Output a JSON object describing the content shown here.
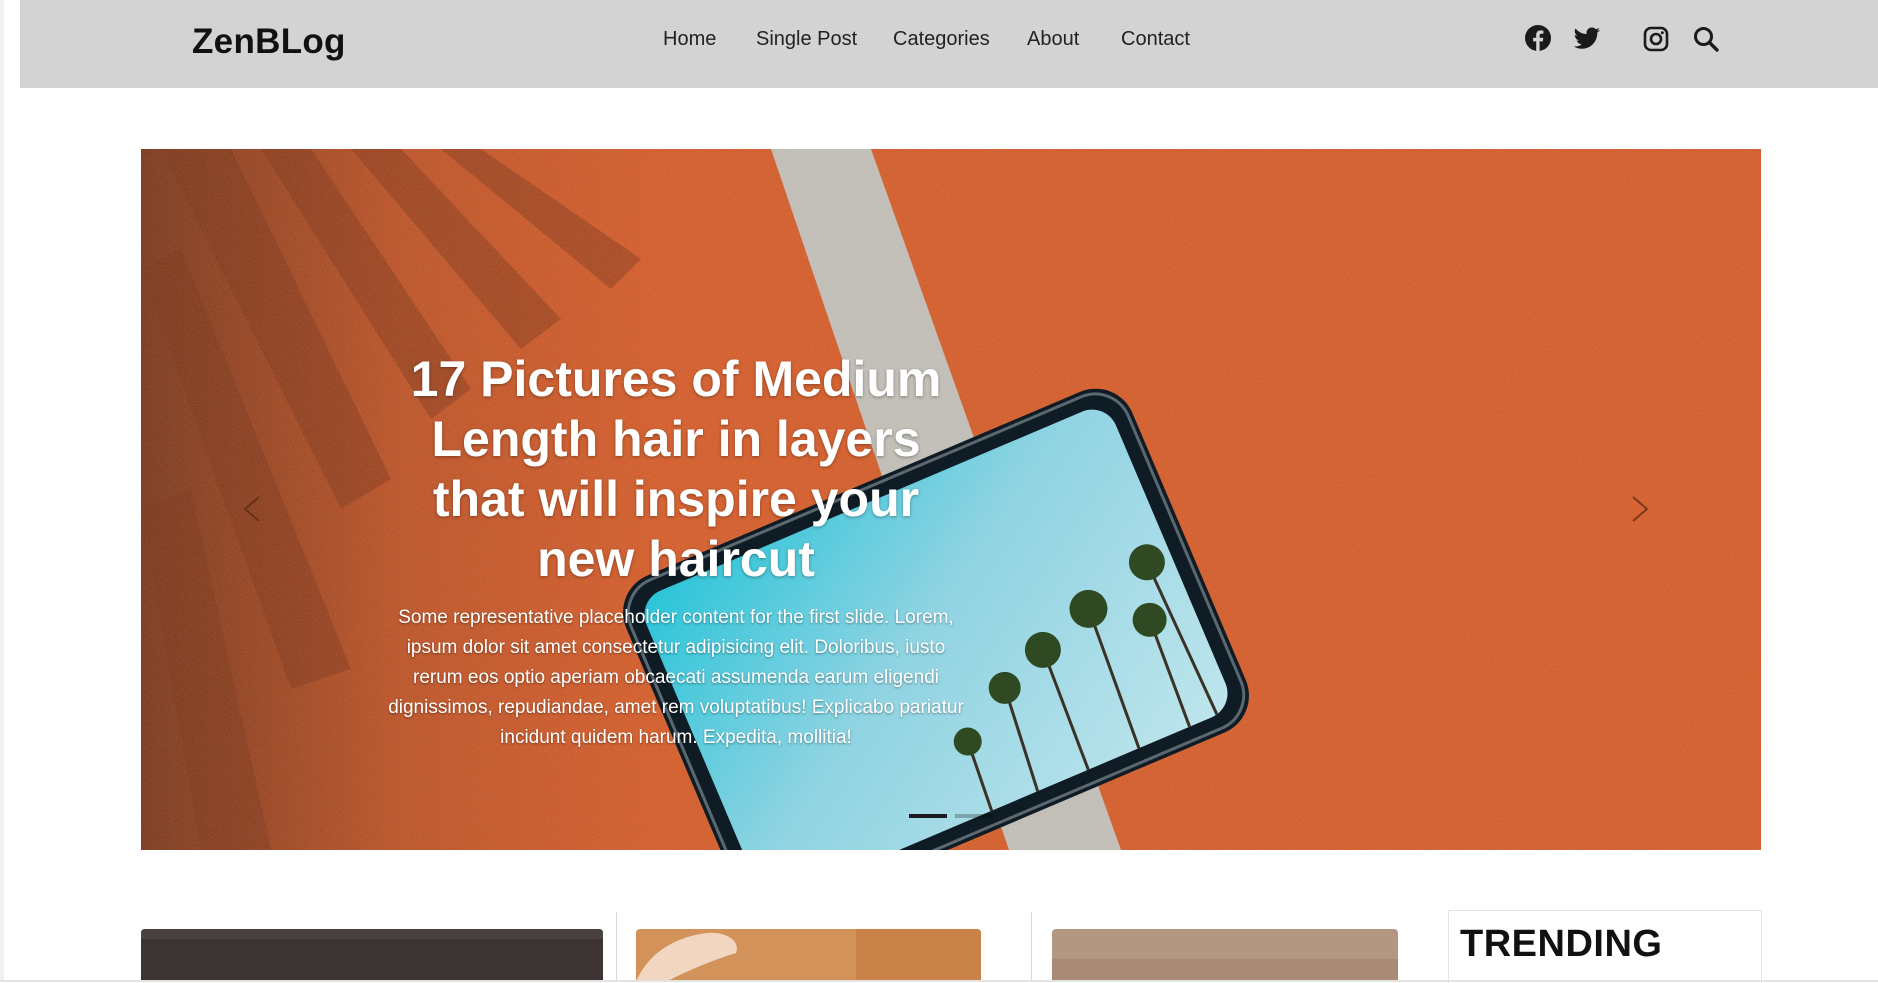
{
  "brand": "ZenBLog",
  "nav": [
    "Home",
    "Single Post",
    "Categories",
    "About",
    "Contact"
  ],
  "social_icons": [
    "facebook-icon",
    "twitter-icon",
    "instagram-icon",
    "search-icon"
  ],
  "slide": {
    "title": "17 Pictures of Medium Length hair in layers that will inspire your new haircut",
    "text": "Some representative placeholder content for the first slide. Lorem, ipsum dolor sit amet consectetur adipisicing elit. Doloribus, iusto rerum eos optio aperiam obcaecati assumenda earum eligendi dignissimos, repudiandae, amet rem voluptatibus! Explicabo pariatur incidunt quidem harum. Expedita, mollitia!"
  },
  "carousel": {
    "indicator_count": 2,
    "active_indicator": 1
  },
  "sidebar": {
    "heading": "TRENDING"
  },
  "colors": {
    "header_bg": "#d3d3d3",
    "track_orange": "#d7551f",
    "lane_line": "#c9c6c0",
    "tablet_screen": "#74c6d8"
  }
}
